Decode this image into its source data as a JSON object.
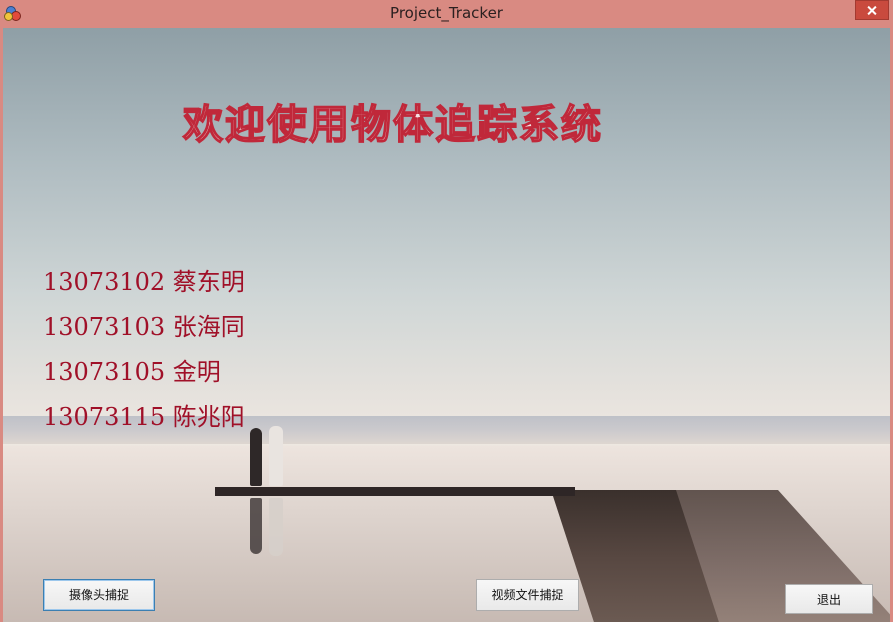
{
  "window": {
    "title": "Project_Tracker"
  },
  "welcome": {
    "heading": "欢迎使用物体追踪系统"
  },
  "members": [
    {
      "label": "13073102 蔡东明"
    },
    {
      "label": "13073103 张海同"
    },
    {
      "label": "13073105 金明"
    },
    {
      "label": "13073115 陈兆阳"
    }
  ],
  "buttons": {
    "camera_capture": "摄像头捕捉",
    "video_file_capture": "视频文件捕捉",
    "exit": "退出"
  },
  "colors": {
    "titlebar": "#d98a82",
    "heading_outline": "#c0283a",
    "member_text": "#a01028"
  },
  "icons": {
    "app": "app-icon",
    "close": "close-icon"
  }
}
